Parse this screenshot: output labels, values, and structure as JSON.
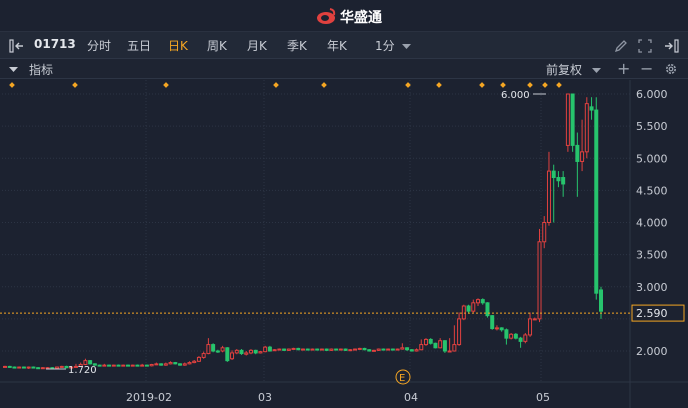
{
  "app": {
    "title": "华盛通"
  },
  "toolbar": {
    "stock_code": "01713",
    "periods": [
      {
        "label": "分时",
        "active": false
      },
      {
        "label": "五日",
        "active": false
      },
      {
        "label": "日K",
        "active": true
      },
      {
        "label": "周K",
        "active": false
      },
      {
        "label": "月K",
        "active": false
      },
      {
        "label": "季K",
        "active": false
      },
      {
        "label": "年K",
        "active": false
      }
    ],
    "minute_select": "1分"
  },
  "indicator_bar": {
    "label": "指标",
    "adjust_select": "前复权"
  },
  "chart_data": {
    "type": "candlestick",
    "y_ticks": [
      "6.000",
      "5.500",
      "5.000",
      "4.500",
      "4.000",
      "3.500",
      "3.000",
      "2.590",
      "2.000"
    ],
    "x_ticks": [
      "2019-02",
      "03",
      "04",
      "05"
    ],
    "ylim": [
      1.6,
      6.1
    ],
    "current_price": "2.590",
    "max_label": "6.000",
    "min_label": "1.720",
    "event_marker": "E",
    "colors": {
      "up": "#e0413f",
      "down": "#27c46d",
      "price_line": "#f5a623",
      "grid": "#2c3444"
    },
    "candles": [
      [
        1.75,
        1.76,
        1.74,
        1.77
      ],
      [
        1.76,
        1.75,
        1.74,
        1.77
      ],
      [
        1.75,
        1.74,
        1.73,
        1.76
      ],
      [
        1.74,
        1.75,
        1.73,
        1.76
      ],
      [
        1.75,
        1.74,
        1.73,
        1.76
      ],
      [
        1.74,
        1.75,
        1.72,
        1.76
      ],
      [
        1.75,
        1.74,
        1.73,
        1.76
      ],
      [
        1.74,
        1.73,
        1.72,
        1.75
      ],
      [
        1.73,
        1.74,
        1.72,
        1.75
      ],
      [
        1.74,
        1.74,
        1.73,
        1.75
      ],
      [
        1.74,
        1.73,
        1.72,
        1.75
      ],
      [
        1.73,
        1.75,
        1.72,
        1.76
      ],
      [
        1.75,
        1.76,
        1.74,
        1.77
      ],
      [
        1.76,
        1.74,
        1.73,
        1.77
      ],
      [
        1.74,
        1.75,
        1.73,
        1.76
      ],
      [
        1.75,
        1.76,
        1.74,
        1.8
      ],
      [
        1.76,
        1.79,
        1.75,
        1.82
      ],
      [
        1.79,
        1.85,
        1.78,
        1.88
      ],
      [
        1.85,
        1.8,
        1.79,
        1.86
      ],
      [
        1.8,
        1.78,
        1.77,
        1.81
      ],
      [
        1.78,
        1.77,
        1.76,
        1.79
      ],
      [
        1.77,
        1.78,
        1.76,
        1.8
      ],
      [
        1.78,
        1.77,
        1.76,
        1.79
      ],
      [
        1.77,
        1.78,
        1.76,
        1.79
      ],
      [
        1.78,
        1.77,
        1.76,
        1.79
      ],
      [
        1.77,
        1.78,
        1.76,
        1.79
      ],
      [
        1.78,
        1.77,
        1.76,
        1.79
      ],
      [
        1.77,
        1.78,
        1.76,
        1.79
      ],
      [
        1.78,
        1.77,
        1.76,
        1.79
      ],
      [
        1.77,
        1.78,
        1.76,
        1.8
      ],
      [
        1.78,
        1.77,
        1.76,
        1.79
      ],
      [
        1.77,
        1.79,
        1.76,
        1.8
      ],
      [
        1.79,
        1.8,
        1.78,
        1.82
      ],
      [
        1.8,
        1.78,
        1.77,
        1.81
      ],
      [
        1.78,
        1.8,
        1.77,
        1.82
      ],
      [
        1.8,
        1.82,
        1.79,
        1.84
      ],
      [
        1.82,
        1.8,
        1.79,
        1.83
      ],
      [
        1.8,
        1.78,
        1.77,
        1.81
      ],
      [
        1.78,
        1.8,
        1.77,
        1.82
      ],
      [
        1.8,
        1.82,
        1.79,
        1.84
      ],
      [
        1.82,
        1.84,
        1.81,
        1.86
      ],
      [
        1.84,
        1.9,
        1.83,
        1.92
      ],
      [
        1.9,
        1.96,
        1.88,
        1.99
      ],
      [
        1.96,
        2.1,
        1.95,
        2.2
      ],
      [
        2.1,
        2.0,
        1.98,
        2.12
      ],
      [
        2.0,
        1.99,
        1.97,
        2.02
      ],
      [
        2.0,
        2.05,
        1.98,
        2.08
      ],
      [
        2.05,
        1.85,
        1.83,
        2.06
      ],
      [
        1.88,
        1.97,
        1.86,
        2.01
      ],
      [
        1.97,
        2.01,
        1.95,
        2.03
      ],
      [
        2.01,
        1.96,
        1.94,
        2.03
      ],
      [
        1.95,
        1.97,
        1.93,
        2.0
      ],
      [
        1.97,
        2.01,
        1.95,
        2.03
      ],
      [
        2.01,
        1.97,
        1.95,
        2.02
      ],
      [
        1.97,
        1.99,
        1.96,
        2.0
      ],
      [
        1.99,
        2.06,
        1.98,
        2.08
      ],
      [
        2.06,
        2.0,
        1.99,
        2.08
      ],
      [
        2.01,
        2.02,
        2.0,
        2.03
      ],
      [
        2.02,
        2.03,
        2.01,
        2.04
      ],
      [
        2.03,
        2.01,
        2.0,
        2.04
      ],
      [
        2.01,
        2.03,
        2.0,
        2.04
      ],
      [
        2.03,
        2.04,
        2.02,
        2.05
      ],
      [
        2.04,
        2.02,
        2.01,
        2.05
      ],
      [
        2.02,
        2.03,
        2.01,
        2.04
      ],
      [
        2.03,
        2.02,
        2.01,
        2.04
      ],
      [
        2.02,
        2.03,
        2.01,
        2.04
      ],
      [
        2.03,
        2.02,
        2.01,
        2.04
      ],
      [
        2.02,
        2.03,
        2.01,
        2.04
      ],
      [
        2.03,
        2.01,
        2.0,
        2.04
      ],
      [
        2.01,
        2.03,
        2.0,
        2.04
      ],
      [
        2.03,
        2.02,
        2.01,
        2.04
      ],
      [
        2.02,
        2.03,
        2.01,
        2.04
      ],
      [
        2.03,
        2.01,
        2.0,
        2.04
      ],
      [
        2.01,
        2.02,
        2.0,
        2.03
      ],
      [
        2.02,
        2.03,
        2.01,
        2.04
      ],
      [
        2.03,
        2.04,
        2.02,
        2.05
      ],
      [
        2.04,
        2.02,
        2.01,
        2.05
      ],
      [
        2.02,
        2.0,
        1.99,
        2.03
      ],
      [
        2.0,
        2.01,
        1.99,
        2.02
      ],
      [
        2.01,
        2.03,
        2.0,
        2.04
      ],
      [
        2.03,
        2.02,
        2.01,
        2.04
      ],
      [
        2.02,
        2.03,
        2.01,
        2.04
      ],
      [
        2.03,
        2.02,
        2.01,
        2.04
      ],
      [
        2.02,
        2.03,
        2.01,
        2.04
      ],
      [
        2.03,
        2.05,
        2.02,
        2.12
      ],
      [
        2.05,
        2.02,
        2.0,
        2.06
      ],
      [
        2.02,
        2.0,
        1.99,
        2.03
      ],
      [
        2.0,
        2.02,
        1.99,
        2.04
      ],
      [
        2.02,
        2.1,
        2.01,
        2.18
      ],
      [
        2.1,
        2.18,
        2.08,
        2.2
      ],
      [
        2.18,
        2.12,
        2.1,
        2.2
      ],
      [
        2.12,
        2.05,
        2.04,
        2.13
      ],
      [
        2.05,
        2.16,
        2.04,
        2.2
      ],
      [
        2.16,
        2.0,
        1.97,
        2.17
      ],
      [
        2.0,
        2.0,
        1.98,
        2.2
      ],
      [
        2.0,
        2.1,
        1.99,
        2.4
      ],
      [
        2.1,
        2.5,
        2.08,
        2.6
      ],
      [
        2.5,
        2.7,
        2.48,
        2.72
      ],
      [
        2.7,
        2.62,
        2.58,
        2.72
      ],
      [
        2.62,
        2.75,
        2.6,
        2.8
      ],
      [
        2.75,
        2.8,
        2.7,
        2.82
      ],
      [
        2.8,
        2.75,
        2.72,
        2.82
      ],
      [
        2.75,
        2.55,
        2.52,
        2.76
      ],
      [
        2.55,
        2.35,
        2.33,
        2.56
      ],
      [
        2.35,
        2.36,
        2.32,
        2.4
      ],
      [
        2.36,
        2.33,
        2.3,
        2.37
      ],
      [
        2.33,
        2.2,
        2.1,
        2.35
      ],
      [
        2.2,
        2.26,
        2.18,
        2.28
      ],
      [
        2.26,
        2.2,
        2.18,
        2.28
      ],
      [
        2.2,
        2.15,
        2.05,
        2.22
      ],
      [
        2.15,
        2.25,
        2.12,
        2.28
      ],
      [
        2.25,
        2.5,
        2.22,
        2.6
      ],
      [
        2.5,
        2.5,
        2.48,
        2.52
      ],
      [
        2.5,
        3.7,
        2.45,
        3.9
      ],
      [
        3.7,
        4.0,
        3.6,
        4.1
      ],
      [
        4.0,
        4.8,
        3.95,
        5.1
      ],
      [
        4.8,
        4.7,
        4.0,
        4.9
      ],
      [
        4.7,
        4.65,
        4.55,
        4.8
      ],
      [
        4.7,
        4.6,
        4.4,
        4.8
      ],
      [
        5.2,
        6.0,
        5.1,
        6.0
      ],
      [
        6.0,
        5.2,
        5.1,
        6.0
      ],
      [
        5.2,
        4.95,
        4.4,
        5.4
      ],
      [
        4.95,
        5.1,
        4.8,
        5.6
      ],
      [
        5.1,
        5.85,
        5.0,
        5.95
      ],
      [
        5.8,
        5.75,
        5.6,
        5.95
      ],
      [
        5.75,
        2.9,
        2.8,
        5.95
      ],
      [
        2.95,
        2.62,
        2.5,
        3.0
      ]
    ]
  }
}
